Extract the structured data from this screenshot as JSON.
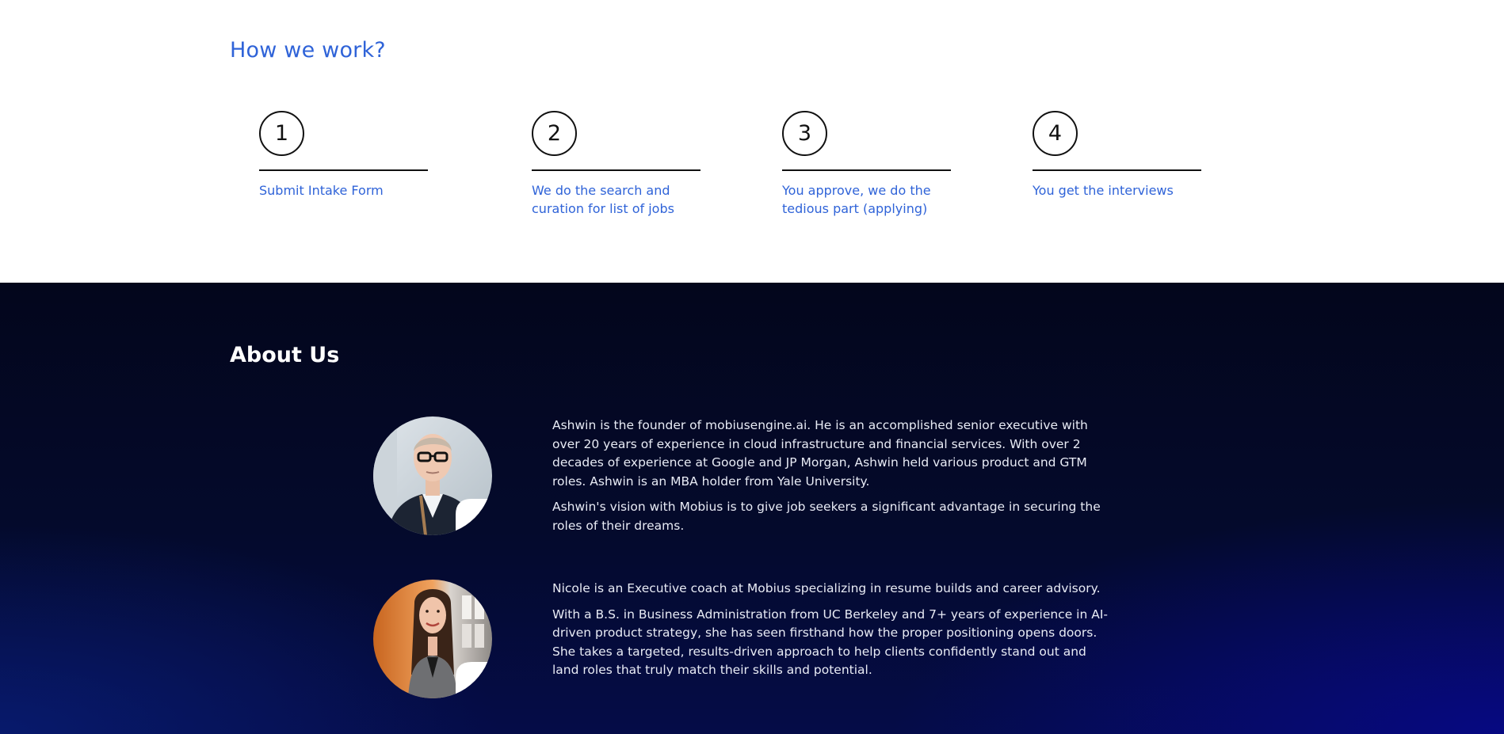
{
  "how_we_work": {
    "title": "How we work?",
    "steps": [
      {
        "number": "1",
        "text": "Submit Intake Form"
      },
      {
        "number": "2",
        "text": "We do the search and curation for list of jobs"
      },
      {
        "number": "3",
        "text": "You approve, we do the tedious part (applying)"
      },
      {
        "number": "4",
        "text": "You get the interviews"
      }
    ]
  },
  "about_us": {
    "title": "About Us",
    "members": [
      {
        "paragraphs": [
          "Ashwin is the founder of mobiusengine.ai. He is an accomplished senior executive with over 20 years of experience in cloud infrastructure and financial services. With over 2 decades of experience at Google and JP Morgan, Ashwin held various product and GTM roles. Ashwin is an MBA holder from Yale University.",
          "Ashwin's vision with Mobius is to give job seekers a significant advantage in securing the roles of their dreams."
        ]
      },
      {
        "paragraphs": [
          "Nicole is an Executive coach at Mobius specializing in resume builds and career advisory.",
          "With a B.S. in Business Administration from UC Berkeley and 7+ years of experience in AI-driven product strategy, she has seen firsthand how the proper positioning opens doors. She takes a targeted, results-driven approach to help clients confidently stand out and land roles that truly match their skills and potential."
        ]
      }
    ]
  },
  "colors": {
    "accent_blue": "#2f63d8",
    "dark_navy": "#03061c",
    "text_light": "#e8ebf5"
  }
}
